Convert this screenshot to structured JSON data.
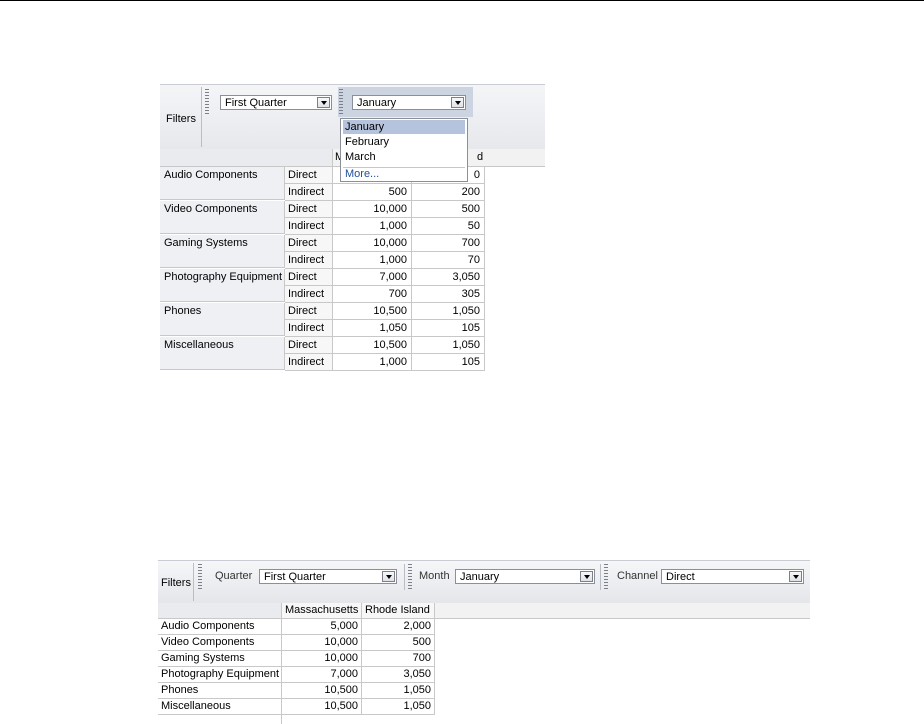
{
  "pivot1": {
    "filters_label": "Filters",
    "quarter_value": "First Quarter",
    "month_value": "January",
    "month_options": [
      "January",
      "February",
      "March"
    ],
    "more_label": "More...",
    "col1_fragment": "M",
    "col2_fragment": "d",
    "rows": [
      {
        "label": "Audio Components",
        "lines": [
          {
            "channel": "Direct",
            "v1": "",
            "v2": "0"
          },
          {
            "channel": "Indirect",
            "v1": "500",
            "v2": "200"
          }
        ]
      },
      {
        "label": "Video Components",
        "lines": [
          {
            "channel": "Direct",
            "v1": "10,000",
            "v2": "500"
          },
          {
            "channel": "Indirect",
            "v1": "1,000",
            "v2": "50"
          }
        ]
      },
      {
        "label": "Gaming Systems",
        "lines": [
          {
            "channel": "Direct",
            "v1": "10,000",
            "v2": "700"
          },
          {
            "channel": "Indirect",
            "v1": "1,000",
            "v2": "70"
          }
        ]
      },
      {
        "label": "Photography Equipment",
        "lines": [
          {
            "channel": "Direct",
            "v1": "7,000",
            "v2": "3,050"
          },
          {
            "channel": "Indirect",
            "v1": "700",
            "v2": "305"
          }
        ]
      },
      {
        "label": "Phones",
        "lines": [
          {
            "channel": "Direct",
            "v1": "10,500",
            "v2": "1,050"
          },
          {
            "channel": "Indirect",
            "v1": "1,050",
            "v2": "105"
          }
        ]
      },
      {
        "label": "Miscellaneous",
        "lines": [
          {
            "channel": "Direct",
            "v1": "10,500",
            "v2": "1,050"
          },
          {
            "channel": "Indirect",
            "v1": "1,000",
            "v2": "105"
          }
        ]
      }
    ]
  },
  "pivot2": {
    "filters_label": "Filters",
    "filters": [
      {
        "label": "Quarter",
        "value": "First Quarter"
      },
      {
        "label": "Month",
        "value": "January"
      },
      {
        "label": "Channel",
        "value": "Direct"
      }
    ],
    "columns": [
      "Massachusetts",
      "Rhode Island"
    ],
    "rows": [
      {
        "label": "Audio Components",
        "v1": "5,000",
        "v2": "2,000"
      },
      {
        "label": "Video Components",
        "v1": "10,000",
        "v2": "500"
      },
      {
        "label": "Gaming Systems",
        "v1": "10,000",
        "v2": "700"
      },
      {
        "label": "Photography Equipment",
        "v1": "7,000",
        "v2": "3,050"
      },
      {
        "label": "Phones",
        "v1": "10,500",
        "v2": "1,050"
      },
      {
        "label": "Miscellaneous",
        "v1": "10,500",
        "v2": "1,050"
      }
    ]
  }
}
